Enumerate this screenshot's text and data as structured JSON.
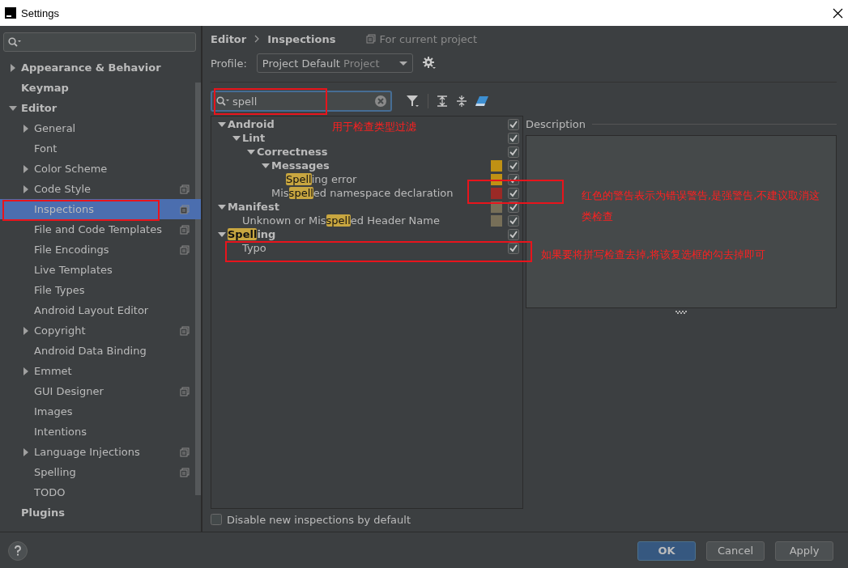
{
  "window": {
    "title": "Settings"
  },
  "sidebar": {
    "items": [
      {
        "label": "Appearance & Behavior",
        "expanded": false,
        "selected": false,
        "project_scope": false
      },
      {
        "label": "Keymap",
        "selected": false,
        "project_scope": false
      },
      {
        "label": "Editor",
        "expanded": true,
        "selected": false,
        "project_scope": false,
        "children": [
          {
            "label": "General",
            "expanded": false,
            "selected": false,
            "project_scope": false
          },
          {
            "label": "Font",
            "selected": false,
            "project_scope": false
          },
          {
            "label": "Color Scheme",
            "expanded": false,
            "selected": false,
            "project_scope": false
          },
          {
            "label": "Code Style",
            "expanded": false,
            "selected": false,
            "project_scope": true
          },
          {
            "label": "Inspections",
            "selected": true,
            "project_scope": true
          },
          {
            "label": "File and Code Templates",
            "selected": false,
            "project_scope": true
          },
          {
            "label": "File Encodings",
            "selected": false,
            "project_scope": true
          },
          {
            "label": "Live Templates",
            "selected": false,
            "project_scope": false
          },
          {
            "label": "File Types",
            "selected": false,
            "project_scope": false
          },
          {
            "label": "Android Layout Editor",
            "selected": false,
            "project_scope": false
          },
          {
            "label": "Copyright",
            "expanded": false,
            "selected": false,
            "project_scope": true
          },
          {
            "label": "Android Data Binding",
            "selected": false,
            "project_scope": false
          },
          {
            "label": "Emmet",
            "expanded": false,
            "selected": false,
            "project_scope": false
          },
          {
            "label": "GUI Designer",
            "selected": false,
            "project_scope": true
          },
          {
            "label": "Images",
            "selected": false,
            "project_scope": false
          },
          {
            "label": "Intentions",
            "selected": false,
            "project_scope": false
          },
          {
            "label": "Language Injections",
            "expanded": false,
            "selected": false,
            "project_scope": true
          },
          {
            "label": "Spelling",
            "selected": false,
            "project_scope": true
          },
          {
            "label": "TODO",
            "selected": false,
            "project_scope": false
          }
        ]
      },
      {
        "label": "Plugins",
        "selected": false,
        "project_scope": false
      }
    ]
  },
  "breadcrumb": [
    "Editor",
    "Inspections"
  ],
  "scope_note": "For current project",
  "profile": {
    "label": "Profile:",
    "value": "Project Default",
    "scope": "Project"
  },
  "search": {
    "value": "spell"
  },
  "inspections": [
    {
      "kind": "group",
      "segments": [
        {
          "text": "Android",
          "match": false
        }
      ],
      "expanded": true,
      "checked": true,
      "children": [
        {
          "kind": "group",
          "segments": [
            {
              "text": "Lint",
              "match": false
            }
          ],
          "expanded": true,
          "checked": true,
          "children": [
            {
              "kind": "group",
              "segments": [
                {
                  "text": "Correctness",
                  "match": false
                }
              ],
              "expanded": true,
              "checked": true,
              "children": [
                {
                  "kind": "group",
                  "segments": [
                    {
                      "text": "Messages",
                      "match": false
                    }
                  ],
                  "expanded": true,
                  "checked": true,
                  "color": "#c09114",
                  "children": [
                    {
                      "kind": "inspection",
                      "segments": [
                        {
                          "text": "Spell",
                          "match": true
                        },
                        {
                          "text": "ing error",
                          "match": false
                        }
                      ],
                      "checked": true,
                      "color": "#c09114"
                    }
                  ]
                },
                {
                  "kind": "inspection",
                  "segments": [
                    {
                      "text": "Mis",
                      "match": false
                    },
                    {
                      "text": "spell",
                      "match": true
                    },
                    {
                      "text": "ed namespace declaration",
                      "match": false
                    }
                  ],
                  "checked": true,
                  "color": "#9b2a26"
                }
              ]
            }
          ]
        }
      ]
    },
    {
      "kind": "group",
      "segments": [
        {
          "text": "Manifest",
          "match": false
        }
      ],
      "expanded": true,
      "checked": true,
      "color": "#776f58",
      "children": [
        {
          "kind": "inspection",
          "segments": [
            {
              "text": "Unknown or Mis",
              "match": false
            },
            {
              "text": "spell",
              "match": true
            },
            {
              "text": "ed Header Name",
              "match": false
            }
          ],
          "checked": true,
          "color": "#776f58"
        }
      ]
    },
    {
      "kind": "group",
      "segments": [
        {
          "text": "Spell",
          "match": true
        },
        {
          "text": "ing",
          "match": false
        }
      ],
      "expanded": true,
      "checked": true,
      "children": [
        {
          "kind": "inspection",
          "segments": [
            {
              "text": "Typo",
              "match": false
            }
          ],
          "checked": true
        }
      ]
    }
  ],
  "description": {
    "title": "Description"
  },
  "disable_new": {
    "label": "Disable new inspections by default",
    "checked": false
  },
  "buttons": [
    {
      "label": "OK",
      "default": true
    },
    {
      "label": "Cancel",
      "default": false
    },
    {
      "label": "Apply",
      "default": false
    }
  ],
  "annotations": [
    {
      "text": "用于检查类型过滤"
    },
    {
      "text": "红色的警告表示为错误警告,是强警告,不建议取消这类检查"
    },
    {
      "text": "如果要将拼写检查去掉,将该复选框的勾去掉即可"
    }
  ]
}
